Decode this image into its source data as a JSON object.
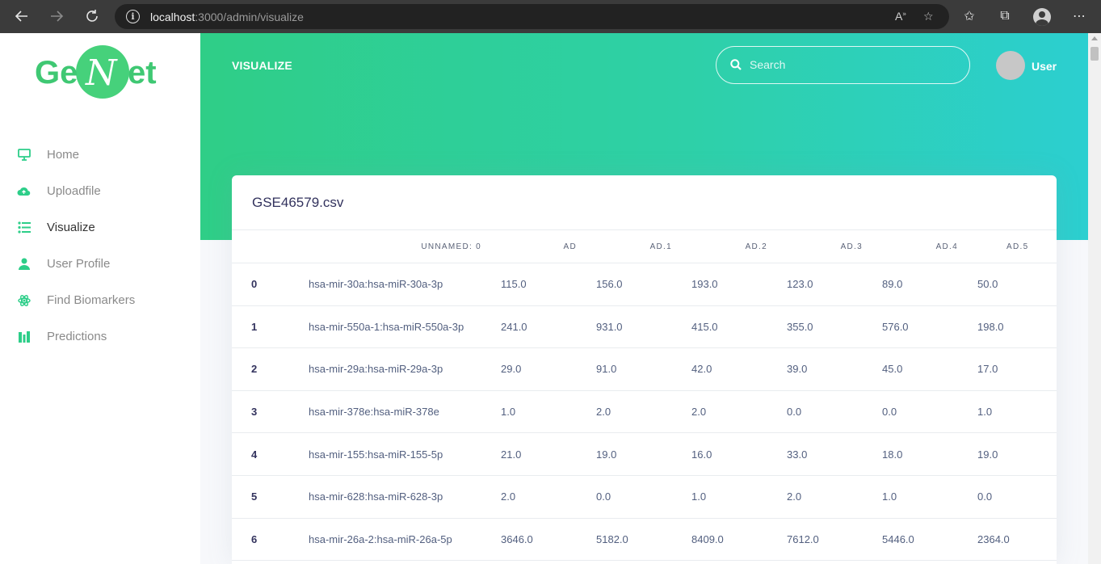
{
  "browser": {
    "url_host": "localhost",
    "url_path": ":3000/admin/visualize"
  },
  "sidebar": {
    "logo_text_left": "Ge",
    "logo_text_mid": "N",
    "logo_text_right": "et",
    "items": [
      {
        "label": "Home",
        "icon": "monitor-icon",
        "active": false
      },
      {
        "label": "Uploadfile",
        "icon": "cloud-upload-icon",
        "active": false
      },
      {
        "label": "Visualize",
        "icon": "list-icon",
        "active": true
      },
      {
        "label": "User Profile",
        "icon": "user-icon",
        "active": false
      },
      {
        "label": "Find Biomarkers",
        "icon": "atom-icon",
        "active": false
      },
      {
        "label": "Predictions",
        "icon": "bars-icon",
        "active": false
      }
    ]
  },
  "header": {
    "title": "VISUALIZE",
    "search_placeholder": "Search",
    "user_name": "User"
  },
  "colors": {
    "accent": "#2dce89",
    "gradient_end": "#2dcecc"
  },
  "card": {
    "title": "GSE46579.csv",
    "columns": [
      "",
      "Unnamed: 0",
      "AD",
      "AD.1",
      "AD.2",
      "AD.3",
      "AD.4",
      "AD.5"
    ],
    "rows": [
      [
        "0",
        "hsa-mir-30a:hsa-miR-30a-3p",
        "115.0",
        "156.0",
        "193.0",
        "123.0",
        "89.0",
        "50.0"
      ],
      [
        "1",
        "hsa-mir-550a-1:hsa-miR-550a-3p",
        "241.0",
        "931.0",
        "415.0",
        "355.0",
        "576.0",
        "198.0"
      ],
      [
        "2",
        "hsa-mir-29a:hsa-miR-29a-3p",
        "29.0",
        "91.0",
        "42.0",
        "39.0",
        "45.0",
        "17.0"
      ],
      [
        "3",
        "hsa-mir-378e:hsa-miR-378e",
        "1.0",
        "2.0",
        "2.0",
        "0.0",
        "0.0",
        "1.0"
      ],
      [
        "4",
        "hsa-mir-155:hsa-miR-155-5p",
        "21.0",
        "19.0",
        "16.0",
        "33.0",
        "18.0",
        "19.0"
      ],
      [
        "5",
        "hsa-mir-628:hsa-miR-628-3p",
        "2.0",
        "0.0",
        "1.0",
        "2.0",
        "1.0",
        "0.0"
      ],
      [
        "6",
        "hsa-mir-26a-2:hsa-miR-26a-5p",
        "3646.0",
        "5182.0",
        "8409.0",
        "7612.0",
        "5446.0",
        "2364.0"
      ]
    ]
  }
}
